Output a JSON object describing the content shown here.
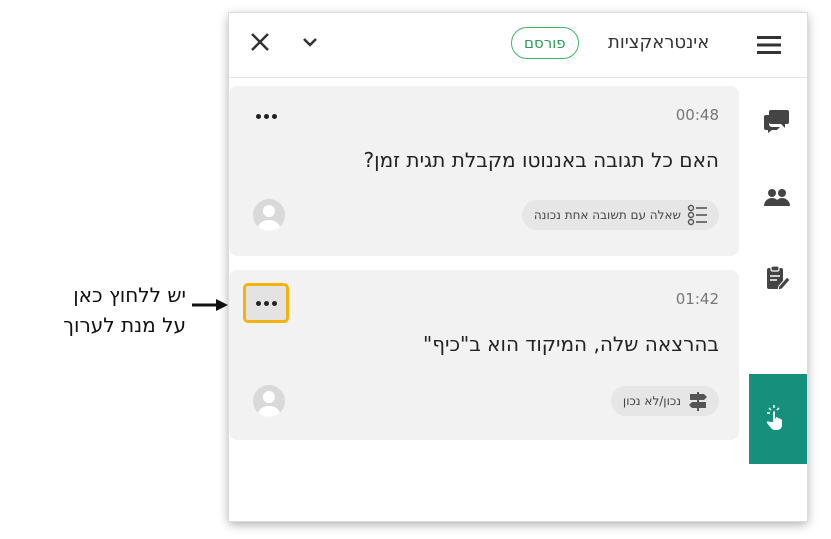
{
  "header": {
    "title": "אינטראקציות",
    "status_badge": "פורסם",
    "icons": {
      "close": "close-icon",
      "collapse": "chevron-down-icon",
      "menu": "hamburger-menu-icon"
    }
  },
  "sidebar": {
    "items": [
      {
        "name": "chat-bubbles-icon",
        "active": false
      },
      {
        "name": "people-icon",
        "active": false
      },
      {
        "name": "clipboard-edit-icon",
        "active": false
      },
      {
        "name": "interaction-tap-icon",
        "active": true
      }
    ],
    "active_color": "#16907d"
  },
  "interactions": [
    {
      "time": "00:48",
      "question": "האם כל תגובה באננוטו מקבלת תגית זמן?",
      "type_label": "שאלה עם תשובה אחת נכונה",
      "type_icon": "list-radio-icon"
    },
    {
      "time": "01:42",
      "question": "בהרצאה שלה, המיקוד הוא ב\"כיף\"",
      "type_label": "נכון/לא נכון",
      "type_icon": "signpost-icon"
    }
  ],
  "annotation": {
    "line1": "יש ללחוץ כאן",
    "line2": "על מנת לערוך",
    "highlight_color": "#f4b30c"
  }
}
